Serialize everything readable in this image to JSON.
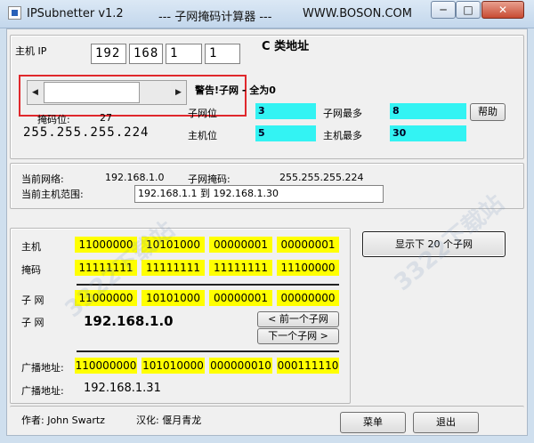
{
  "window": {
    "app_title": "IPSubnetter v1.2",
    "subtitle": "--- 子网掩码计算器 ---",
    "site": "WWW.BOSON.COM",
    "min_label": "─",
    "max_label": "□",
    "close_label": "✕"
  },
  "host_ip": {
    "label": "主机 IP",
    "octets": [
      "192",
      "168",
      "1",
      "1"
    ],
    "class_label": "C 类地址"
  },
  "mask_control": {
    "warning": "警告!子网 - 全为0",
    "mask_bits_label": "掩码位:",
    "mask_bits_value": "27",
    "mask_value": "255.255.255.224",
    "subnet_bits_label": "子网位",
    "subnet_bits_value": "3",
    "host_bits_label": "主机位",
    "host_bits_value": "5",
    "max_subnets_label": "子网最多",
    "max_subnets_value": "8",
    "max_hosts_label": "主机最多",
    "max_hosts_value": "30",
    "help_label": "帮助",
    "scroll_value": 0.0
  },
  "current": {
    "network_label": "当前网络:",
    "network_value": "192.168.1.0",
    "mask_label": "子网掩码:",
    "mask_value": "255.255.255.224",
    "range_label": "当前主机范围:",
    "range_value": "192.168.1.1  到 192.168.1.30"
  },
  "binary": {
    "host_label": "主机",
    "host": [
      "11000000",
      "10101000",
      "00000001",
      "00000001"
    ],
    "mask_label": "掩码",
    "mask": [
      "11111111",
      "11111111",
      "11111111",
      "11100000"
    ],
    "subnet_label": "子 网",
    "subnet": [
      "11000000",
      "10101000",
      "00000001",
      "00000000"
    ],
    "subnet2_label": "子 网",
    "subnet_value": "192.168.1.0",
    "prev_label": "< 前一个子网",
    "next_label": "下一个子网 >",
    "broadcast_label": "广播地址:",
    "broadcast": [
      "110000000",
      "101010000",
      "000000010",
      "000111110"
    ],
    "broadcast2_label": "广播地址:",
    "broadcast_value": "192.168.1.31"
  },
  "show_next_label": "显示下 20 个子网",
  "footer": {
    "author": "作者: John Swartz",
    "translator": "汉化: 偃月青龙",
    "menu_label": "菜单",
    "exit_label": "退出"
  },
  "watermark": "3322下载站",
  "colors": {
    "cyan": "#33f3f3",
    "yellow": "#ffff00",
    "red_outline": "#e0282c"
  }
}
